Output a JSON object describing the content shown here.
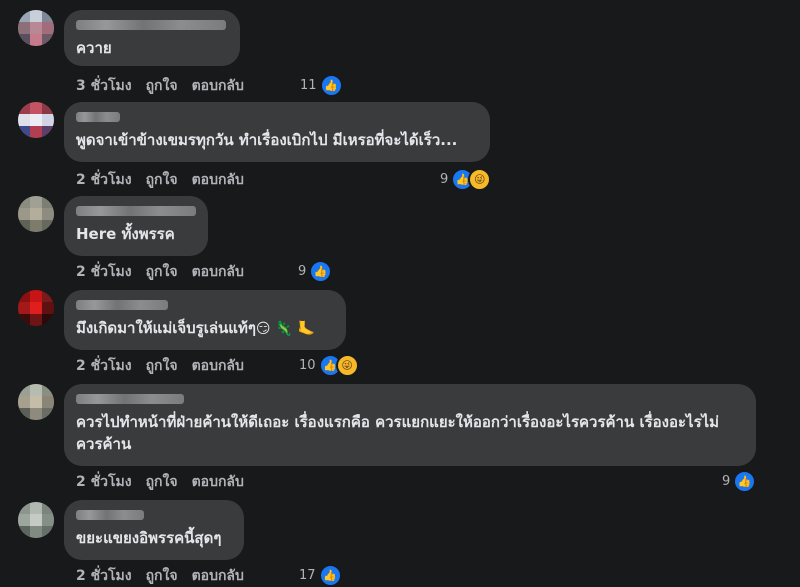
{
  "actions": {
    "like_label": "ถูกใจ",
    "reply_label": "ตอบกลับ"
  },
  "comments": [
    {
      "text": "ควาย",
      "time": "3 ชั่วโมง",
      "reactions": "11"
    },
    {
      "text": "พูดจาเข้าข้างเขมรทุกวัน ทำเรื่องเบิกไป มีเหรอที่จะได้เร็ว...",
      "time": "2 ชั่วโมง",
      "reactions": "9"
    },
    {
      "text": "Here ทั้งพรรค",
      "time": "2 ชั่วโมง",
      "reactions": "9"
    },
    {
      "text": "มึงเกิดมาให้แม่เจ็บรูเล่นแท้ๆ",
      "emojis": "😏 🦎 🦶",
      "time": "2 ชั่วโมง",
      "reactions": "10"
    },
    {
      "text": "ควรไปทำหน้าที่ฝ่ายค้านให้ดีเถอะ เรื่องแรกคือ ควรแยกแยะให้ออกว่าเรื่องอะไรควรค้าน เรื่องอะไรไม่ควรค้าน",
      "time": "2 ชั่วโมง",
      "reactions": "9"
    },
    {
      "text": "ขยะแขยงอิพรรคนี้สุดๆ",
      "time": "2 ชั่วโมง",
      "reactions": "17"
    }
  ]
}
